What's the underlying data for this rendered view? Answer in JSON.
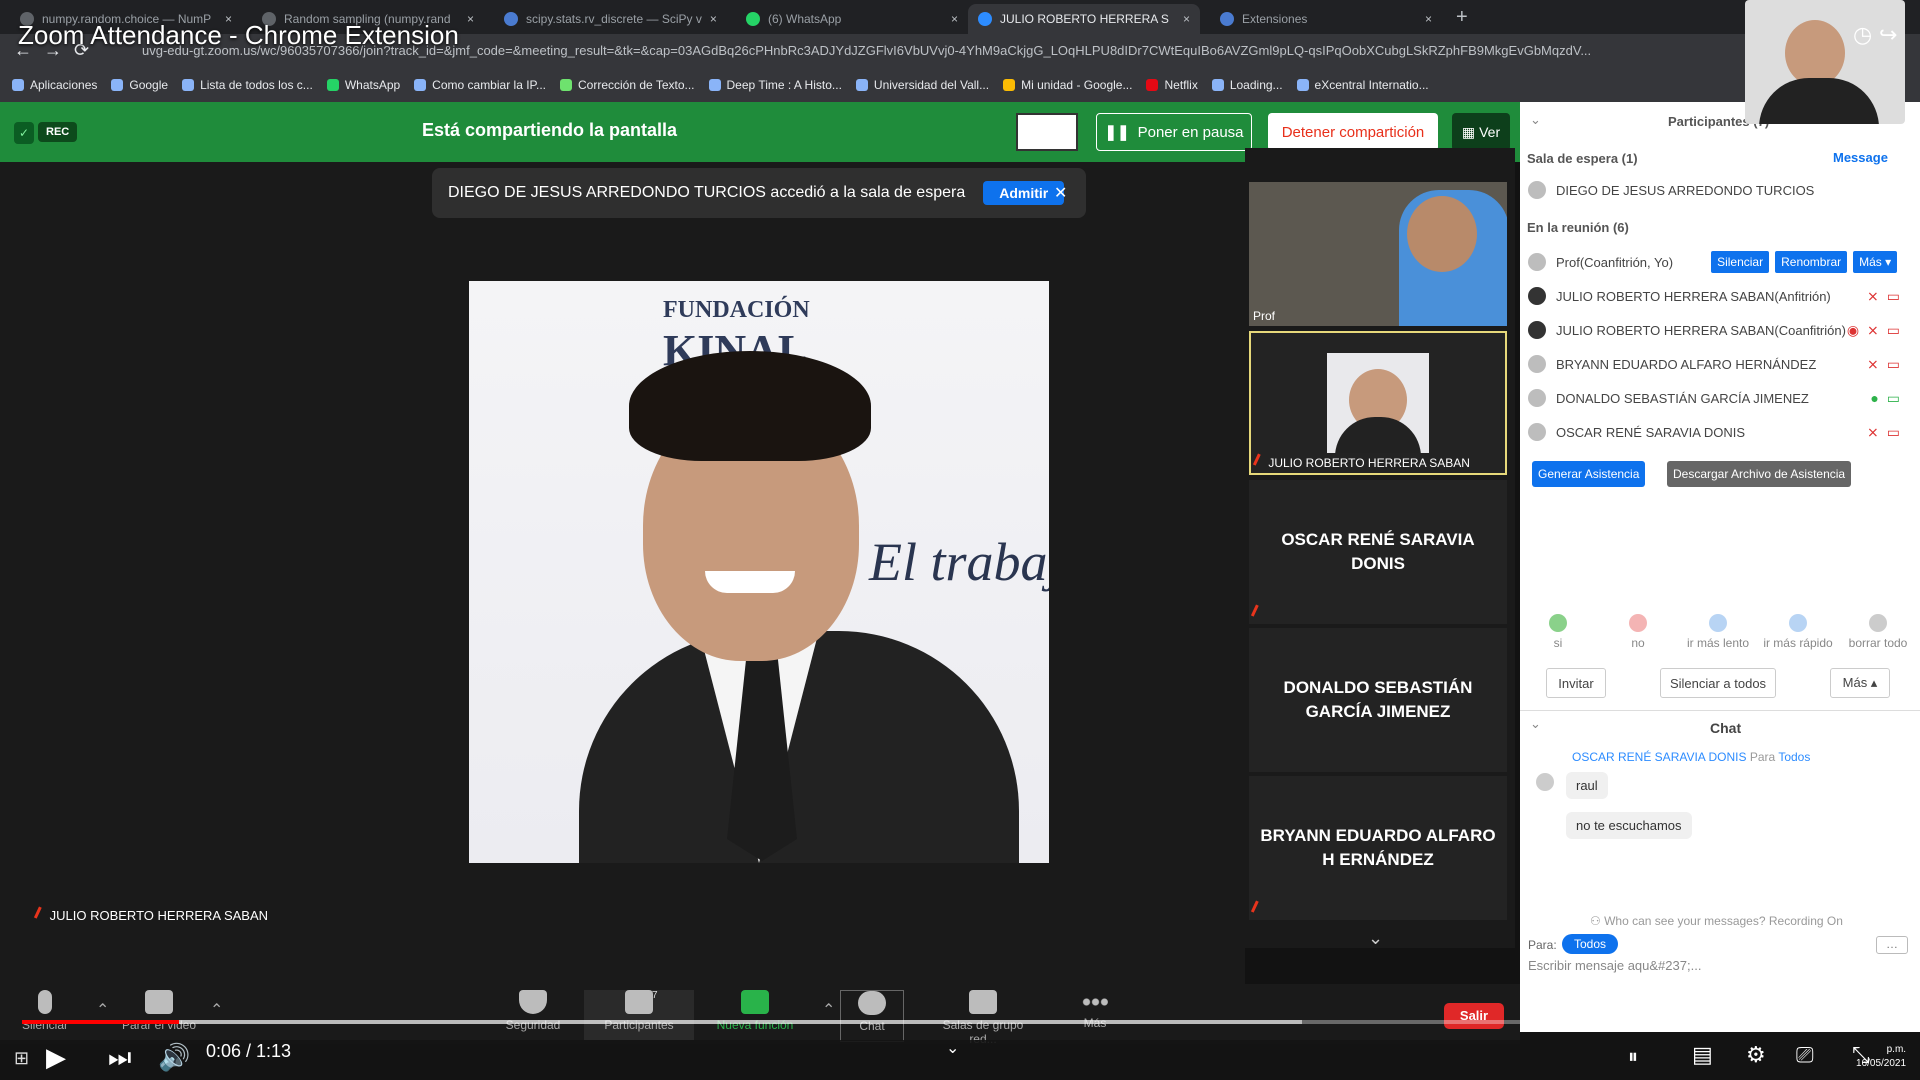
{
  "video_title": "Zoom Attendance - Chrome Extension",
  "browser": {
    "tabs": [
      {
        "label": "numpy.random.choice — NumP",
        "active": false
      },
      {
        "label": "Random sampling (numpy.rand",
        "active": false
      },
      {
        "label": "scipy.stats.rv_discrete — SciPy v",
        "active": false
      },
      {
        "label": "(6) WhatsApp",
        "active": false
      },
      {
        "label": "JULIO ROBERTO HERRERA S",
        "active": true
      },
      {
        "label": "Extensiones",
        "active": false
      }
    ],
    "new_tab_icon": "plus-icon",
    "url": "uvg-edu-gt.zoom.us/wc/96035707366/join?track_id=&jmf_code=&meeting_result=&tk=&cap=03AGdBq26cPHnbRc3ADJYdJZGFlvI6VbUVvj0-4YhM9aCkjgG_LOqHLPU8dIDr7CWtEquIBo6AVZGml9pLQ-qsIPqOobXCubgLSkRZphFB9MkgEvGbMqzdV...",
    "bookmarks": [
      "Aplicaciones",
      "Google",
      "Lista de todos los c...",
      "WhatsApp",
      "Como cambiar la IP...",
      "Corrección de Texto...",
      "Deep Time : A Histo...",
      "Universidad del Vall...",
      "Mi unidad - Google...",
      "Netflix",
      "Loading...",
      "eXcentral Internatio..."
    ]
  },
  "zoom_top": {
    "rec_label": "REC",
    "sharing_text": "Está compartiendo la pantalla",
    "pause_label": "Poner en pausa",
    "stop_label": "Detener compartición",
    "view_label": "Ver"
  },
  "waiting_banner": {
    "text": "DIEGO DE JESUS ARREDONDO TURCIOS accedió a la sala de espera",
    "admit_label": "Admitir"
  },
  "main_video": {
    "speaker_name": "JULIO ROBERTO HERRERA SABAN",
    "photo_text_1": "FUNDACIÓN",
    "photo_text_2": "KINAL",
    "photo_text_3": "El trabajo"
  },
  "gallery": [
    {
      "name": "Prof",
      "type": "video"
    },
    {
      "name": "JULIO ROBERTO HERRERA SABAN",
      "type": "video"
    },
    {
      "name": "OSCAR RENÉ SARAVIA DONIS",
      "type": "name"
    },
    {
      "name": "DONALDO SEBASTIÁN GARCÍA JIMENEZ",
      "type": "name"
    },
    {
      "name": "BRYANN EDUARDO ALFARO H ERNÁNDEZ",
      "type": "name"
    }
  ],
  "participants": {
    "header": "Participantes (7)",
    "waiting_title": "Sala de espera (1)",
    "message_label": "Message",
    "waiting_person": "DIEGO DE JESUS ARREDONDO TURCIOS",
    "meeting_title": "En la reunión (6)",
    "rows": [
      {
        "name": "Prof(Coanfitrión, Yo)"
      },
      {
        "name": "JULIO ROBERTO HERRERA SABAN(Anfitrión)"
      },
      {
        "name": "JULIO ROBERTO HERRERA SABAN(Coanfitrión)"
      },
      {
        "name": "BRYANN EDUARDO ALFARO HERNÁNDEZ"
      },
      {
        "name": "DONALDO SEBASTIÁN GARCÍA JIMENEZ"
      },
      {
        "name": "OSCAR RENÉ SARAVIA DONIS"
      }
    ],
    "mute_label": "Silenciar",
    "rename_label": "Renombrar",
    "more_label": "Más ▾",
    "generate_label": "Generar Asistencia",
    "download_label": "Descargar Archivo de Asistencia",
    "reactions": [
      "si",
      "no",
      "ir más lento",
      "ir más rápido",
      "borrar todo"
    ],
    "invite_label": "Invitar",
    "mute_all_label": "Silenciar a todos",
    "more2_label": "Más ▴"
  },
  "chat": {
    "title": "Chat",
    "sender": "OSCAR RENÉ SARAVIA DONIS",
    "to_word": "Para",
    "to_target": "Todos",
    "messages": [
      "raul",
      "no te escuchamos"
    ],
    "privacy_note": "Who can see your messages? Recording On",
    "to_label": "Para:",
    "to_value": "Todos",
    "input_placeholder": "Escribir mensaje aqu&#237;..."
  },
  "zoom_toolbar": {
    "mute": "Silenciar",
    "video": "Parar el video",
    "security": "Seguridad",
    "participants": "Participantes",
    "participants_count": "7",
    "share": "Nueva función",
    "chat": "Chat",
    "rooms": "Salas de grupo red...",
    "more": "Más",
    "leave": "Salir"
  },
  "player": {
    "time": "0:06 / 1:13",
    "progress_fraction": 0.084,
    "clock_time": "p.m.",
    "clock_date": "16/05/2021"
  }
}
